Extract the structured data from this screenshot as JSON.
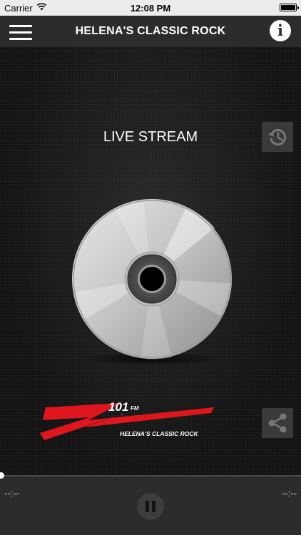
{
  "status_bar": {
    "carrier": "Carrier",
    "time": "12:08 PM",
    "icons": [
      "wifi-icon",
      "battery-icon"
    ]
  },
  "nav": {
    "title": "HELENA'S CLASSIC ROCK",
    "left_icon": "hamburger-menu-icon",
    "right_icon": "info-icon",
    "right_icon_glyph": "i"
  },
  "main": {
    "stream_label": "LIVE STREAM",
    "history_icon": "history-icon",
    "share_icon": "share-icon",
    "artwork": "cd-disc",
    "station_logo": {
      "number": "101",
      "band": "FM",
      "tagline": "HELENA'S CLASSIC ROCK"
    }
  },
  "player": {
    "progress": 0,
    "elapsed": "--:--",
    "remaining": "--:--",
    "control_icon": "pause-icon"
  },
  "colors": {
    "navbar": "#2c2c2c",
    "background": "#121212",
    "logo_red": "#e0161f",
    "accent_white": "#ffffff"
  }
}
